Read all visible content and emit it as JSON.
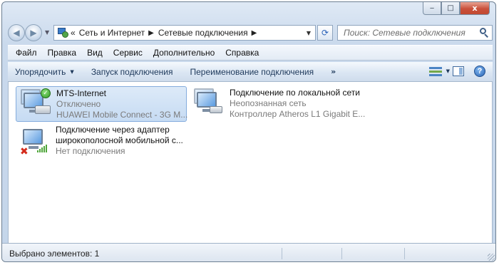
{
  "window": {
    "caption_buttons": {
      "minimize": "‒",
      "maximize": "□",
      "close": "x"
    }
  },
  "nav": {
    "back_icon": "back-arrow-icon",
    "forward_icon": "forward-arrow-icon",
    "breadcrumb_overflow": "«",
    "breadcrumb": [
      "Сеть и Интернет",
      "Сетевые подключения"
    ],
    "refresh_icon": "refresh-icon",
    "search_placeholder": "Поиск: Сетевые подключения"
  },
  "menu": {
    "items": [
      "Файл",
      "Правка",
      "Вид",
      "Сервис",
      "Дополнительно",
      "Справка"
    ]
  },
  "toolbar": {
    "organize": "Упорядочить",
    "connect": "Запуск подключения",
    "rename": "Переименование подключения",
    "more": "»",
    "help": "?"
  },
  "connections": [
    {
      "name": "MTS-Internet",
      "status": "Отключено",
      "device": "HUAWEI Mobile Connect - 3G M...",
      "selected": true,
      "icon": "modem-connection-icon"
    },
    {
      "name": "Подключение по локальной сети",
      "status": "Неопознанная сеть",
      "device": "Контроллер Atheros L1 Gigabit E...",
      "selected": false,
      "icon": "lan-connection-icon"
    },
    {
      "name_line1": "Подключение через адаптер",
      "name_line2": "широкополосной мобильной с...",
      "status": "Нет подключения",
      "selected": false,
      "icon": "mobile-broadband-icon"
    }
  ],
  "statusbar": {
    "text": "Выбрано элементов: 1"
  },
  "colors": {
    "selection": "#c6dbf3",
    "ok_badge": "#2e9a22",
    "error_badge": "#d42b1c"
  }
}
